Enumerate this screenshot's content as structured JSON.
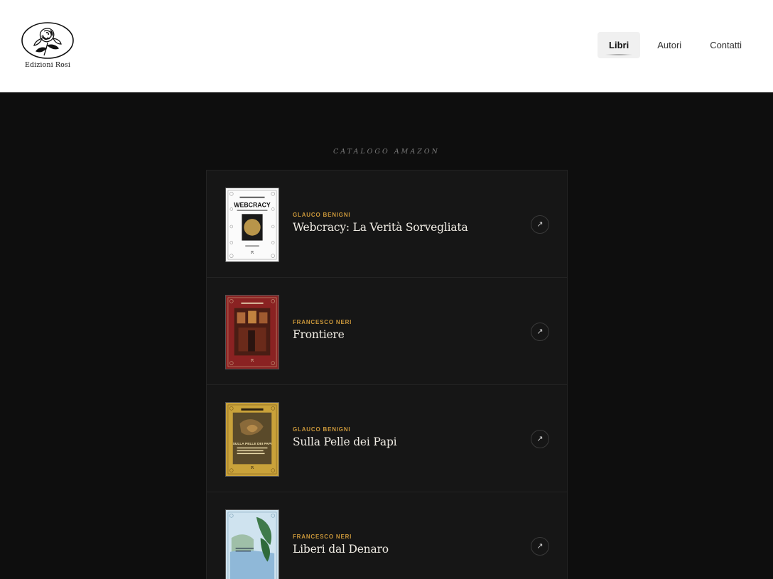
{
  "brand": {
    "name": "Edizioni Rosi"
  },
  "nav": [
    {
      "label": "Libri",
      "active": true
    },
    {
      "label": "Autori",
      "active": false
    },
    {
      "label": "Contatti",
      "active": false
    }
  ],
  "catalog": {
    "label": "CATALOGO AMAZON",
    "books": [
      {
        "author": "GLAUCO BENIGNI",
        "title": "Webcracy: La Verità Sorvegliata",
        "cover_text": "WEBCRACY"
      },
      {
        "author": "FRANCESCO NERI",
        "title": "Frontiere"
      },
      {
        "author": "GLAUCO BENIGNI",
        "title": "Sulla Pelle dei Papi",
        "cover_text": "SULLA PELLE DEI PAPI"
      },
      {
        "author": "FRANCESCO NERI",
        "title": "Liberi dal Denaro"
      }
    ]
  },
  "colors": {
    "accent": "#c9963a",
    "background": "#0e0e0e",
    "card": "#161616"
  },
  "icons": {
    "arrow": "arrow-up-right-icon"
  }
}
